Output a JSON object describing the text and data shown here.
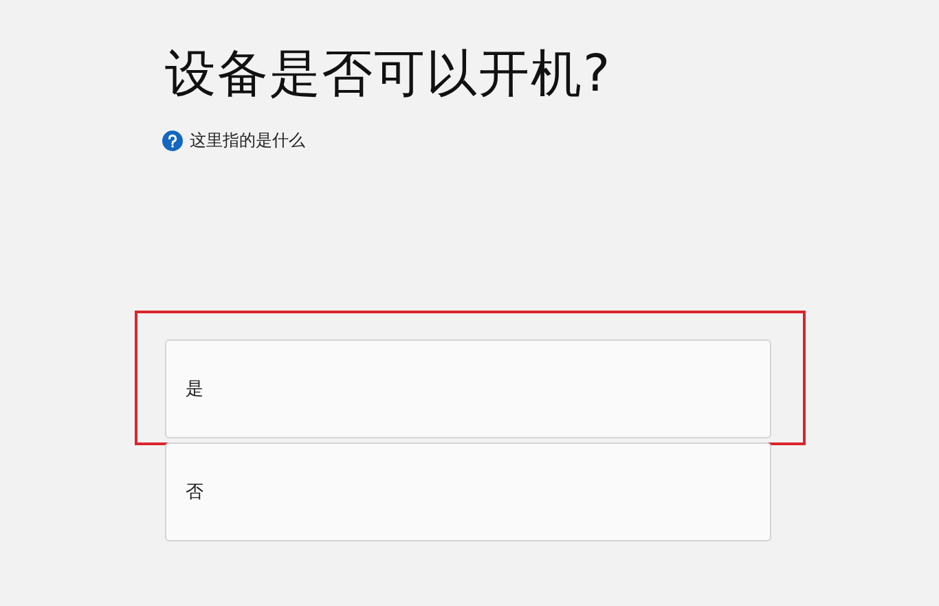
{
  "title": "设备是否可以开机?",
  "help_link": "这里指的是什么",
  "options": [
    {
      "label": "是",
      "highlighted": true
    },
    {
      "label": "否",
      "highlighted": false
    }
  ]
}
